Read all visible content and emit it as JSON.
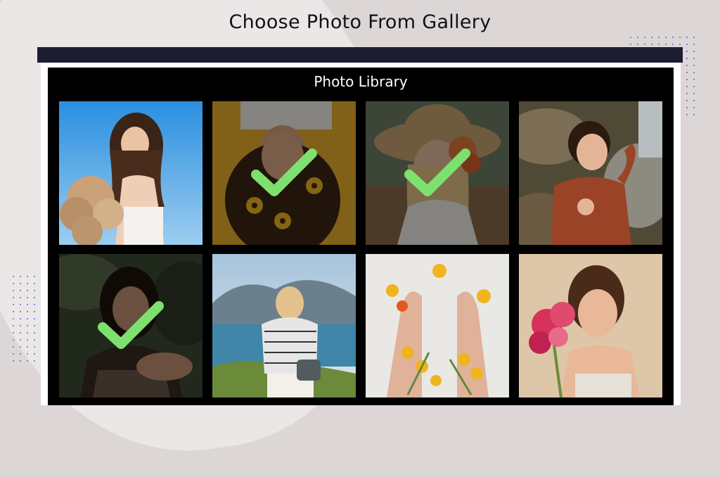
{
  "header": {
    "title": "Choose Photo From Gallery"
  },
  "library": {
    "title": "Photo Library",
    "photos": [
      {
        "subject": "woman with dried flowers, blue sky",
        "selected": false
      },
      {
        "subject": "upside-down woman with sunflowers on yellow",
        "selected": true
      },
      {
        "subject": "woman in straw hat with orange flower",
        "selected": true
      },
      {
        "subject": "smiling woman in brown sweater by rocks",
        "selected": false
      },
      {
        "subject": "woman portrait, dark green background",
        "selected": true
      },
      {
        "subject": "traveller photographing coastline",
        "selected": false
      },
      {
        "subject": "hands with yellow flowers on white",
        "selected": false
      },
      {
        "subject": "woman holding pink flowers",
        "selected": false
      }
    ]
  },
  "colors": {
    "accent_check": "#7ee06e",
    "topbar": "#1e1c33",
    "panel": "#000000",
    "dots": "#6a63e0"
  }
}
